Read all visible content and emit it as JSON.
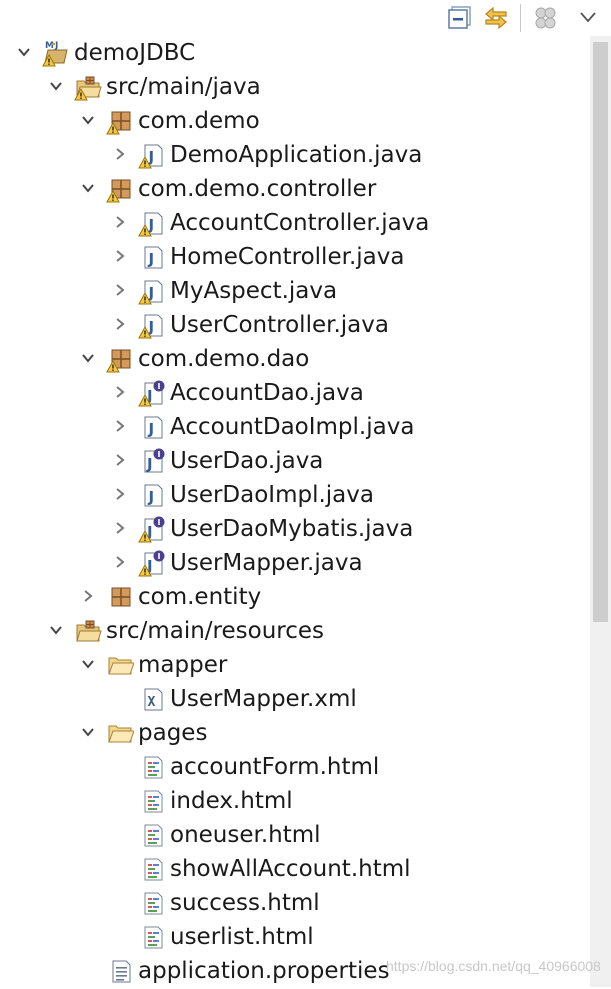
{
  "toolbar": {
    "buttons": [
      {
        "name": "collapse-all-icon"
      },
      {
        "name": "link-with-editor-icon"
      },
      {
        "name": "focus-active-task-icon"
      },
      {
        "name": "view-menu-icon"
      }
    ]
  },
  "tree": [
    {
      "label": "demoJDBC",
      "depth": 0,
      "twisty": "expanded",
      "icon": "project",
      "warn": true
    },
    {
      "label": "src/main/java",
      "depth": 1,
      "twisty": "expanded",
      "icon": "source-folder",
      "warn": true
    },
    {
      "label": "com.demo",
      "depth": 2,
      "twisty": "expanded",
      "icon": "package",
      "warn": true
    },
    {
      "label": "DemoApplication.java",
      "depth": 3,
      "twisty": "collapsed",
      "icon": "java",
      "warn": true
    },
    {
      "label": "com.demo.controller",
      "depth": 2,
      "twisty": "expanded",
      "icon": "package",
      "warn": true
    },
    {
      "label": "AccountController.java",
      "depth": 3,
      "twisty": "collapsed",
      "icon": "java",
      "warn": true
    },
    {
      "label": "HomeController.java",
      "depth": 3,
      "twisty": "collapsed",
      "icon": "java",
      "warn": false
    },
    {
      "label": "MyAspect.java",
      "depth": 3,
      "twisty": "collapsed",
      "icon": "java",
      "warn": true
    },
    {
      "label": "UserController.java",
      "depth": 3,
      "twisty": "collapsed",
      "icon": "java",
      "warn": true
    },
    {
      "label": "com.demo.dao",
      "depth": 2,
      "twisty": "expanded",
      "icon": "package",
      "warn": true
    },
    {
      "label": "AccountDao.java",
      "depth": 3,
      "twisty": "collapsed",
      "icon": "java-interface",
      "warn": true
    },
    {
      "label": "AccountDaoImpl.java",
      "depth": 3,
      "twisty": "collapsed",
      "icon": "java",
      "warn": false
    },
    {
      "label": "UserDao.java",
      "depth": 3,
      "twisty": "collapsed",
      "icon": "java-interface",
      "warn": false
    },
    {
      "label": "UserDaoImpl.java",
      "depth": 3,
      "twisty": "collapsed",
      "icon": "java",
      "warn": false
    },
    {
      "label": "UserDaoMybatis.java",
      "depth": 3,
      "twisty": "collapsed",
      "icon": "java-interface",
      "warn": true
    },
    {
      "label": "UserMapper.java",
      "depth": 3,
      "twisty": "collapsed",
      "icon": "java-interface",
      "warn": true
    },
    {
      "label": "com.entity",
      "depth": 2,
      "twisty": "collapsed",
      "icon": "package",
      "warn": false
    },
    {
      "label": "src/main/resources",
      "depth": 1,
      "twisty": "expanded",
      "icon": "source-folder",
      "warn": false
    },
    {
      "label": "mapper",
      "depth": 2,
      "twisty": "expanded",
      "icon": "folder",
      "warn": false
    },
    {
      "label": "UserMapper.xml",
      "depth": 3,
      "twisty": "none",
      "icon": "xml",
      "warn": false
    },
    {
      "label": "pages",
      "depth": 2,
      "twisty": "expanded",
      "icon": "folder",
      "warn": false
    },
    {
      "label": "accountForm.html",
      "depth": 3,
      "twisty": "none",
      "icon": "html",
      "warn": false
    },
    {
      "label": "index.html",
      "depth": 3,
      "twisty": "none",
      "icon": "html",
      "warn": false
    },
    {
      "label": "oneuser.html",
      "depth": 3,
      "twisty": "none",
      "icon": "html",
      "warn": false
    },
    {
      "label": "showAllAccount.html",
      "depth": 3,
      "twisty": "none",
      "icon": "html",
      "warn": false
    },
    {
      "label": "success.html",
      "depth": 3,
      "twisty": "none",
      "icon": "html",
      "warn": false
    },
    {
      "label": "userlist.html",
      "depth": 3,
      "twisty": "none",
      "icon": "html",
      "warn": false
    },
    {
      "label": "application.properties",
      "depth": 2,
      "twisty": "none",
      "icon": "properties",
      "warn": false
    }
  ],
  "watermark": "https://blog.csdn.net/qq_40966008"
}
